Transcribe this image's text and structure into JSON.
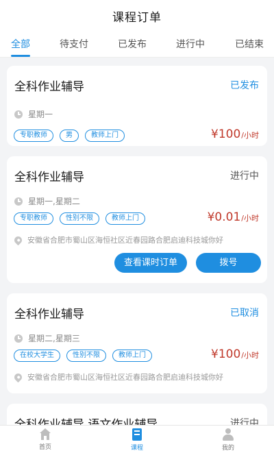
{
  "header": {
    "title": "课程订单"
  },
  "tabs": [
    {
      "label": "全部"
    },
    {
      "label": "待支付"
    },
    {
      "label": "已发布"
    },
    {
      "label": "进行中"
    },
    {
      "label": "已结束"
    }
  ],
  "orders": [
    {
      "title": "全科作业辅导",
      "status": "已发布",
      "time": "星期一",
      "tags": [
        "专职教师",
        "男",
        "教师上门"
      ],
      "price": "¥100",
      "unit": "/小时"
    },
    {
      "title": "全科作业辅导",
      "status": "进行中",
      "time": "星期一,星期二",
      "tags": [
        "专职教师",
        "性别不限",
        "教师上门"
      ],
      "price": "¥0.01",
      "unit": "/小时",
      "address": "安徽省合肥市蜀山区海恒社区近春园路合肥启迪科技城你好",
      "buttons": [
        "查看课时订单",
        "拨号"
      ]
    },
    {
      "title": "全科作业辅导",
      "status": "已取消",
      "time": "星期二,星期三",
      "tags": [
        "在校大学生",
        "性别不限",
        "教师上门"
      ],
      "price": "¥100",
      "unit": "/小时",
      "address": "安徽省合肥市蜀山区海恒社区近春园路合肥启迪科技城你好"
    },
    {
      "title": "全科作业辅导,语文作业辅导",
      "status": "进行中"
    }
  ],
  "nav": [
    {
      "label": "首页",
      "icon": "home-icon"
    },
    {
      "label": "课程",
      "icon": "course-icon"
    },
    {
      "label": "我的",
      "icon": "user-icon"
    }
  ],
  "colors": {
    "accent": "#1f8ee0",
    "price": "#c0392b"
  }
}
